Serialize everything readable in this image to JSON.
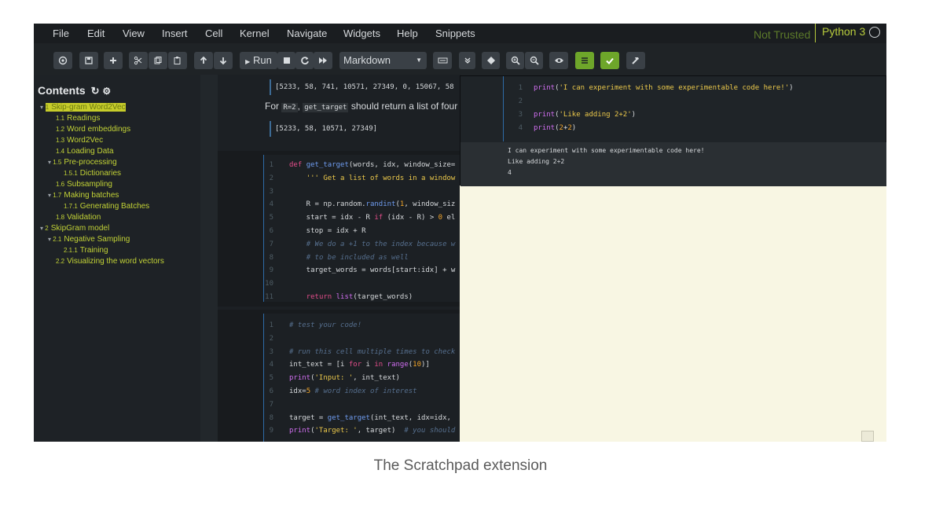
{
  "menu": [
    "File",
    "Edit",
    "View",
    "Insert",
    "Cell",
    "Kernel",
    "Navigate",
    "Widgets",
    "Help",
    "Snippets"
  ],
  "status": {
    "trust": "Not Trusted",
    "kernel": "Python 3"
  },
  "toolbar": {
    "run_label": "Run",
    "cell_type": "Markdown"
  },
  "toc": {
    "title": "Contents",
    "items": [
      {
        "num": "1",
        "label": "Skip-gram Word2Vec",
        "highlight": true
      },
      {
        "num": "1.1",
        "label": "Readings"
      },
      {
        "num": "1.2",
        "label": "Word embeddings"
      },
      {
        "num": "1.3",
        "label": "Word2Vec"
      },
      {
        "num": "1.4",
        "label": "Loading Data"
      },
      {
        "num": "1.5",
        "label": "Pre-processing"
      },
      {
        "num": "1.5.1",
        "label": "Dictionaries"
      },
      {
        "num": "1.6",
        "label": "Subsampling"
      },
      {
        "num": "1.7",
        "label": "Making batches"
      },
      {
        "num": "1.7.1",
        "label": "Generating Batches"
      },
      {
        "num": "1.8",
        "label": "Validation"
      },
      {
        "num": "2",
        "label": "SkipGram model"
      },
      {
        "num": "2.1",
        "label": "Negative Sampling"
      },
      {
        "num": "2.1.1",
        "label": "Training"
      },
      {
        "num": "2.2",
        "label": "Visualizing the word vectors"
      }
    ]
  },
  "notebook": {
    "out1": "[5233, 58, 741, 10571, 27349, 0, 15067, 58",
    "md_for": "For",
    "md_r2": "R=2",
    "md_fn": "get_target",
    "md_rest": "should return a list of four",
    "out2": "[5233, 58, 10571, 27349]",
    "cell1": [
      {
        "n": "1",
        "t": "def get_target(words, idx, window_size="
      },
      {
        "n": "2",
        "t": "    ''' Get a list of words in a window"
      },
      {
        "n": "3",
        "t": ""
      },
      {
        "n": "4",
        "t": "    R = np.random.randint(1, window_siz"
      },
      {
        "n": "5",
        "t": "    start = idx - R if (idx - R) > 0 el"
      },
      {
        "n": "6",
        "t": "    stop = idx + R"
      },
      {
        "n": "7",
        "t": "    # We do a +1 to the index because w"
      },
      {
        "n": "8",
        "t": "    # to be included as well"
      },
      {
        "n": "9",
        "t": "    target_words = words[start:idx] + w"
      },
      {
        "n": "10",
        "t": ""
      },
      {
        "n": "11",
        "t": "    return list(target_words)"
      }
    ],
    "cell2": [
      {
        "n": "1",
        "t": "# test your code!"
      },
      {
        "n": "2",
        "t": ""
      },
      {
        "n": "3",
        "t": "# run this cell multiple times to check"
      },
      {
        "n": "4",
        "t": "int_text = [i for i in range(10)]"
      },
      {
        "n": "5",
        "t": "print('Input: ', int_text)"
      },
      {
        "n": "6",
        "t": "idx=5 # word index of interest"
      },
      {
        "n": "7",
        "t": ""
      },
      {
        "n": "8",
        "t": "target = get_target(int_text, idx=idx,"
      },
      {
        "n": "9",
        "t": "print('Target: ', target)  # you should"
      }
    ]
  },
  "scratchpad": {
    "code": [
      {
        "n": "1",
        "t": "print('I can experiment with some experimentable code here!')"
      },
      {
        "n": "2",
        "t": ""
      },
      {
        "n": "3",
        "t": "print('Like adding 2+2')"
      },
      {
        "n": "4",
        "t": "print(2+2)"
      }
    ],
    "output": [
      "I can experiment with some experimentable code here!",
      "Like adding 2+2",
      "4"
    ]
  },
  "caption": "The Scratchpad extension"
}
